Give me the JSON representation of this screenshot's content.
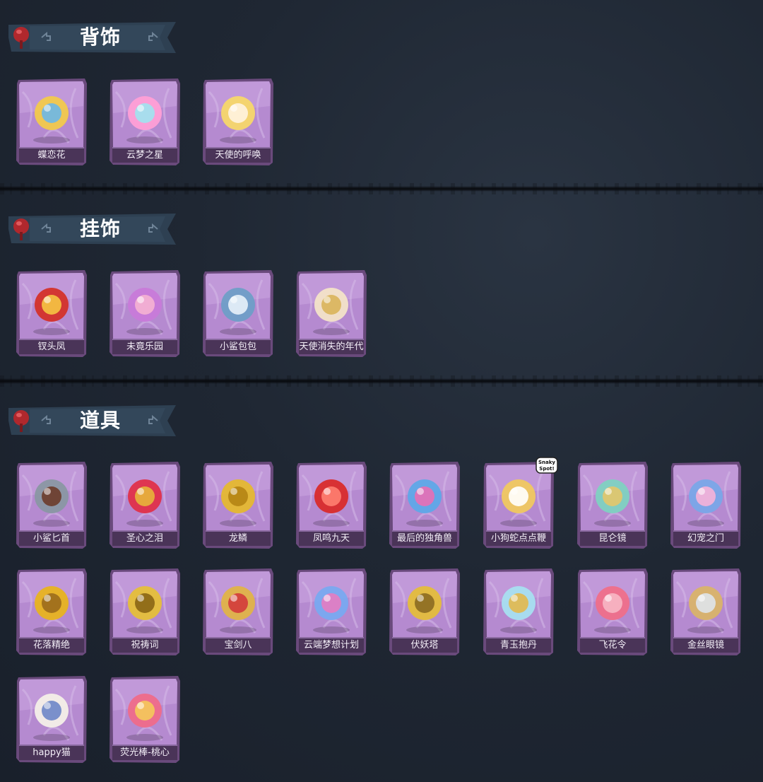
{
  "sections": [
    {
      "title": "背饰",
      "items": [
        {
          "name": "蝶恋花",
          "icon": "butterfly-bell-icon"
        },
        {
          "name": "云梦之星",
          "icon": "unicorn-cloud-icon"
        },
        {
          "name": "天使的呼唤",
          "icon": "angel-doll-icon"
        }
      ]
    },
    {
      "title": "挂饰",
      "items": [
        {
          "name": "钗头凤",
          "icon": "phoenix-crown-doll-icon"
        },
        {
          "name": "未竟乐园",
          "icon": "candy-girl-doll-icon"
        },
        {
          "name": "小鲨包包",
          "icon": "shark-bag-icon"
        },
        {
          "name": "天使消失的年代",
          "icon": "halo-girl-icon"
        }
      ]
    },
    {
      "title": "道具",
      "items": [
        {
          "name": "小鲨匕首",
          "icon": "shark-dagger-icon"
        },
        {
          "name": "圣心之泪",
          "icon": "ruby-scepter-icon"
        },
        {
          "name": "龙鳞",
          "icon": "golden-shovel-icon"
        },
        {
          "name": "凤鸣九天",
          "icon": "red-sword-icon"
        },
        {
          "name": "最后的独角兽",
          "icon": "unicorn-horn-icon"
        },
        {
          "name": "小狗蛇点点鞭",
          "icon": "snake-whip-icon"
        },
        {
          "name": "昆仑镜",
          "icon": "jade-mirror-icon"
        },
        {
          "name": "幻宠之门",
          "icon": "pet-device-icon"
        },
        {
          "name": "花落精绝",
          "icon": "gold-flower-chain-icon"
        },
        {
          "name": "祝祷词",
          "icon": "gold-cross-icon"
        },
        {
          "name": "宝剑八",
          "icon": "heart-locket-icon"
        },
        {
          "name": "云端梦想计划",
          "icon": "star-wand-icon"
        },
        {
          "name": "伏妖塔",
          "icon": "golden-pagoda-icon"
        },
        {
          "name": "青玉抱丹",
          "icon": "jade-vase-icon"
        },
        {
          "name": "飞花令",
          "icon": "flower-bouquet-icon"
        },
        {
          "name": "金丝眼镜",
          "icon": "glasses-icon"
        },
        {
          "name": "happy猫",
          "icon": "dancing-cat-icon"
        },
        {
          "name": "荧光棒-桃心",
          "icon": "heart-wand-icon"
        }
      ]
    }
  ],
  "badge": {
    "text": "Snaky Spot!"
  },
  "colors": {
    "background": "#1f2733",
    "card_purple": "#a878c4",
    "card_border": "#6e4e80",
    "banner": "#2c3d4f",
    "pin": "#b0282d"
  }
}
